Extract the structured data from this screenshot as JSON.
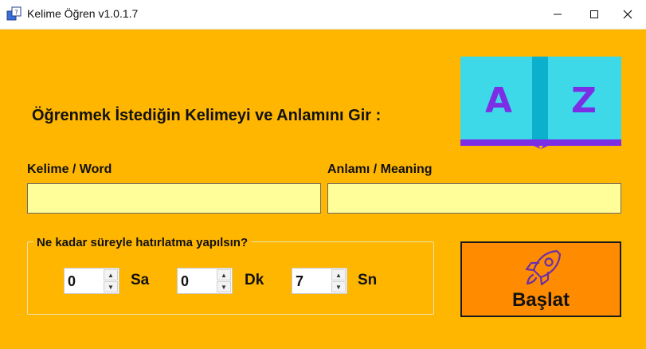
{
  "window": {
    "title": "Kelime Öğren v1.0.1.7",
    "app_icon": "dictionary-icon",
    "controls": [
      "minimize-icon",
      "maximize-icon",
      "close-icon"
    ]
  },
  "main": {
    "heading": "Öğrenmek İstediğin Kelimeyi ve Anlamını Gir :",
    "logo": {
      "icon": "a-to-z-book-icon",
      "left_letter": "A",
      "right_letter": "Z"
    },
    "word_label": "Kelime / Word",
    "word_value": "",
    "meaning_label": "Anlamı / Meaning",
    "meaning_value": ""
  },
  "reminder": {
    "title": "Ne kadar süreyle hatırlatma yapılsın?",
    "hours": {
      "value": "0",
      "unit": "Sa"
    },
    "minutes": {
      "value": "0",
      "unit": "Dk"
    },
    "seconds": {
      "value": "7",
      "unit": "Sn"
    }
  },
  "start_button": {
    "label": "Başlat",
    "icon": "rocket-icon"
  },
  "colors": {
    "background": "#ffb600",
    "input_background": "#fffe99",
    "button_background": "#ff8c00",
    "logo_teal": "#3dd9e8",
    "logo_purple": "#7c2ee6",
    "rocket_purple": "#6b2fa8"
  }
}
